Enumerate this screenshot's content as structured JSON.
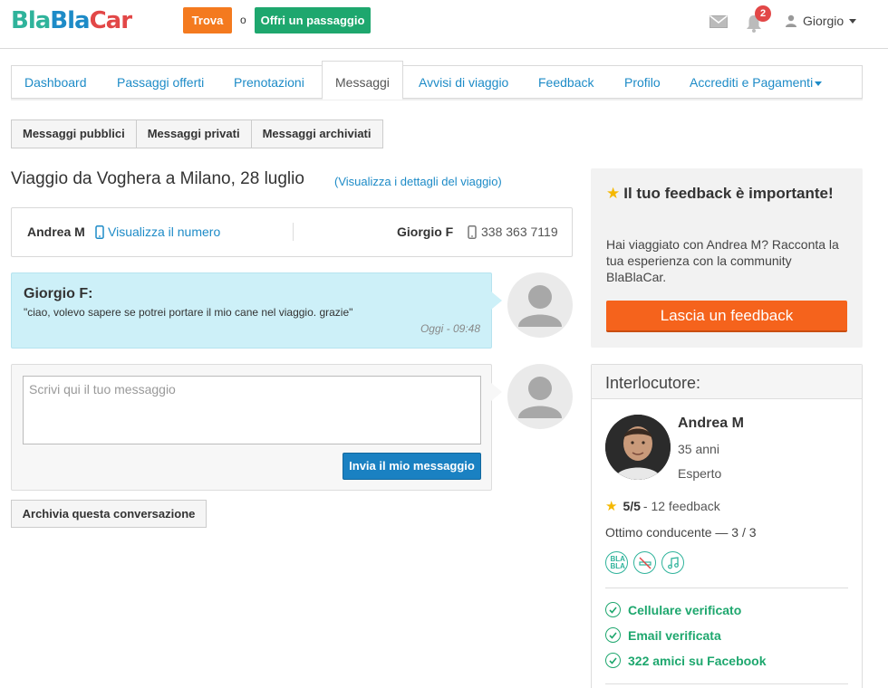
{
  "header": {
    "logo": {
      "part1": "Bla",
      "part2": "Bla",
      "part3": "Car"
    },
    "find_label": "Trova",
    "or_text": "o",
    "offer_label": "Offri un passaggio",
    "notification_count": "2",
    "user_name": "Giorgio"
  },
  "tabs": [
    {
      "label": "Dashboard"
    },
    {
      "label": "Passaggi offerti"
    },
    {
      "label": "Prenotazioni"
    },
    {
      "label": "Messaggi"
    },
    {
      "label": "Avvisi di viaggio"
    },
    {
      "label": "Feedback"
    },
    {
      "label": "Profilo"
    },
    {
      "label": "Accrediti e Pagamenti"
    }
  ],
  "subtabs": [
    {
      "label": "Messaggi pubblici"
    },
    {
      "label": "Messaggi privati"
    },
    {
      "label": "Messaggi archiviati"
    }
  ],
  "trip": {
    "title": "Viaggio da Voghera a Milano, 28 luglio",
    "details_link": "(Visualizza i dettagli del viaggio)"
  },
  "contact": {
    "other_name": "Andrea M",
    "show_number": "Visualizza il numero",
    "self_name": "Giorgio F",
    "self_number": "338 363 7119"
  },
  "message": {
    "author": "Giorgio F:",
    "text": "\"ciao, volevo sapere se potrei portare il mio cane nel viaggio. grazie\"",
    "time": "Oggi - 09:48"
  },
  "compose": {
    "placeholder": "Scrivi qui il tuo messaggio",
    "send_label": "Invia il mio messaggio",
    "archive_label": "Archivia questa conversazione"
  },
  "feedback_panel": {
    "title": "Il tuo feedback è importante!",
    "text": "Hai viaggiato con Andrea M? Racconta la tua esperienza con la community BlaBlaCar.",
    "button": "Lascia un feedback"
  },
  "interlocutor": {
    "heading": "Interlocutore:",
    "name": "Andrea M",
    "age": "35 anni",
    "level": "Esperto",
    "rating_score": "5/5",
    "rating_count": "- 12 feedback",
    "driver_rating": "Ottimo conducente — 3 / 3",
    "pref_chat": "BLA BLA",
    "verifications": [
      {
        "label": "Cellulare verificato"
      },
      {
        "label": "Email verificata"
      },
      {
        "label": "322 amici su Facebook"
      }
    ]
  },
  "colors": {
    "teal": "#2fb39b",
    "blue": "#1d8bc7",
    "red": "#e24747",
    "orange": "#f47a1f",
    "green": "#1ea76e"
  }
}
